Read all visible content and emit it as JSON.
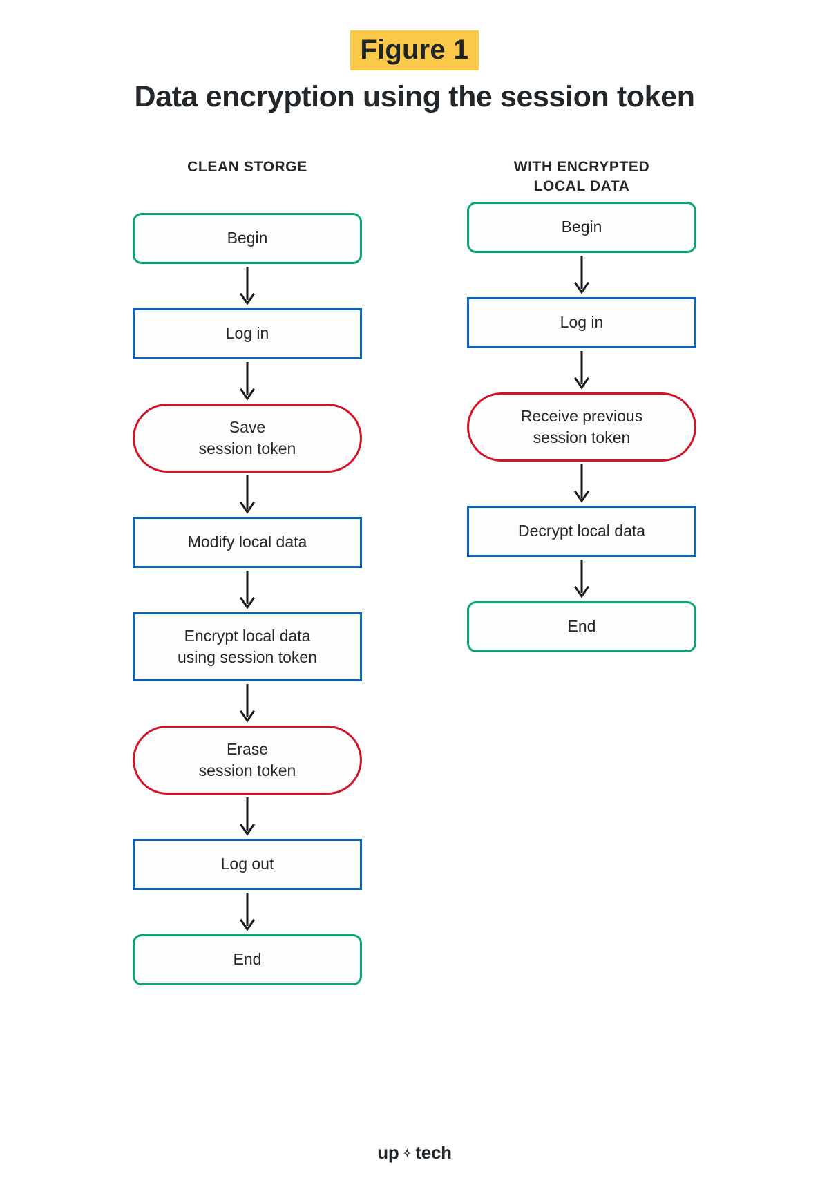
{
  "figure": {
    "badge": "Figure 1",
    "title": "Data encryption using the session token",
    "badge_color": "#fbc94a"
  },
  "colors": {
    "terminal_border": "#09a86b",
    "process_border": "#0b63b8",
    "token_border": "#d2132a",
    "text": "#22272b",
    "arrow": "#1a1a1a",
    "background": "#ffffff"
  },
  "flowcharts": [
    {
      "id": "clean-storage",
      "title": "CLEAN STORGE",
      "title_lines": [
        "CLEAN STORGE"
      ],
      "nodes": [
        {
          "label": "Begin",
          "type": "terminal",
          "lines": [
            "Begin"
          ]
        },
        {
          "label": "Log in",
          "type": "process",
          "lines": [
            "Log in"
          ]
        },
        {
          "label": "Save session token",
          "type": "token",
          "lines": [
            "Save",
            "session token"
          ]
        },
        {
          "label": "Modify local data",
          "type": "process",
          "lines": [
            "Modify local data"
          ]
        },
        {
          "label": "Encrypt local data using session token",
          "type": "process",
          "lines": [
            "Encrypt local data",
            "using session token"
          ]
        },
        {
          "label": "Erase session token",
          "type": "token",
          "lines": [
            "Erase",
            "session token"
          ]
        },
        {
          "label": "Log out",
          "type": "process",
          "lines": [
            "Log out"
          ]
        },
        {
          "label": "End",
          "type": "terminal",
          "lines": [
            "End"
          ]
        }
      ]
    },
    {
      "id": "with-encrypted-local-data",
      "title": "WITH ENCRYPTED LOCAL DATA",
      "title_lines": [
        "WITH ENCRYPTED",
        "LOCAL DATA"
      ],
      "nodes": [
        {
          "label": "Begin",
          "type": "terminal",
          "lines": [
            "Begin"
          ]
        },
        {
          "label": "Log in",
          "type": "process",
          "lines": [
            "Log in"
          ]
        },
        {
          "label": "Receive previous session token",
          "type": "token",
          "lines": [
            "Receive previous",
            "session token"
          ]
        },
        {
          "label": "Decrypt local data",
          "type": "process",
          "lines": [
            "Decrypt local data"
          ]
        },
        {
          "label": "End",
          "type": "terminal",
          "lines": [
            "End"
          ]
        }
      ]
    }
  ],
  "footer": {
    "logo_prefix": "up",
    "logo_suffix": "tech",
    "logo_name": "uptech"
  }
}
